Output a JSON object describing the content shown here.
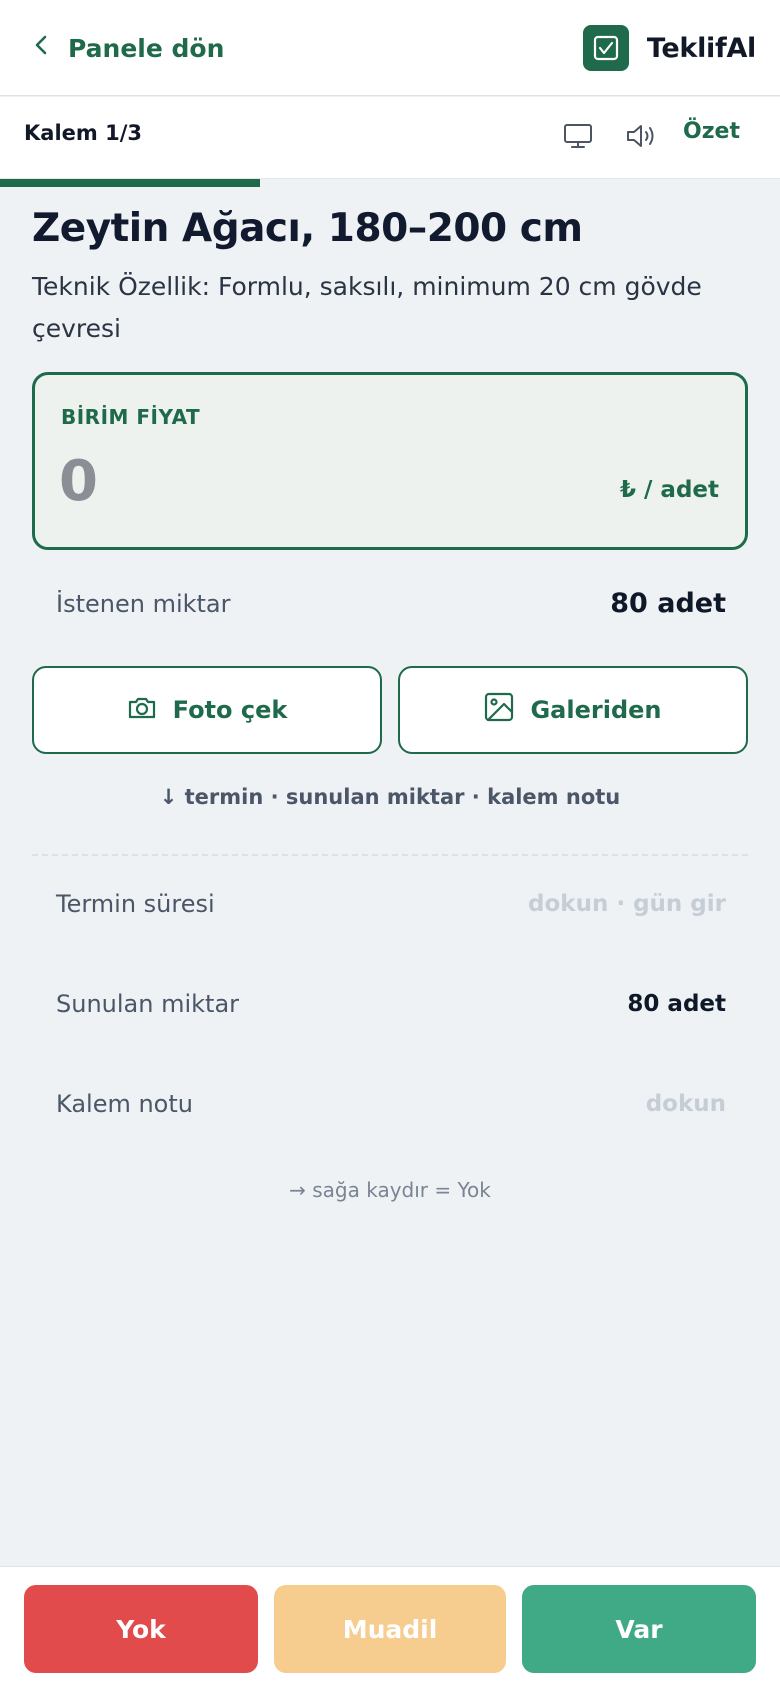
{
  "header": {
    "back_label": "Panele dön",
    "brand_name": "TeklifAl"
  },
  "subheader": {
    "counter": "Kalem 1/3",
    "summary_label": "Özet"
  },
  "progress": {
    "current": 1,
    "total": 3,
    "fraction": 0.333
  },
  "item": {
    "title": "Zeytin Ağacı, 180–200 cm",
    "spec": "Teknik Özellik: Formlu, saksılı, minimum 20 cm gövde çevresi"
  },
  "price": {
    "label": "BİRİM FİYAT",
    "value": "0",
    "unit": "₺ / adet"
  },
  "requested": {
    "label": "İstenen miktar",
    "value": "80 adet"
  },
  "photo_buttons": {
    "camera_label": "Foto çek",
    "gallery_label": "Galeriden"
  },
  "hint": "↓ termin · sunulan miktar · kalem notu",
  "fields": {
    "termin": {
      "label": "Termin süresi",
      "placeholder": "dokun · gün gir"
    },
    "offered": {
      "label": "Sunulan miktar",
      "value": "80 adet"
    },
    "note": {
      "label": "Kalem notu",
      "placeholder": "dokun"
    }
  },
  "swipe_hint": "→ sağa kaydır = Yok",
  "actions": {
    "no": "Yok",
    "alt": "Muadil",
    "yes": "Var"
  },
  "colors": {
    "brand": "#1f6a4a",
    "no": "#e14b4b",
    "alt": "#f6cc8f",
    "yes": "#40a985"
  }
}
